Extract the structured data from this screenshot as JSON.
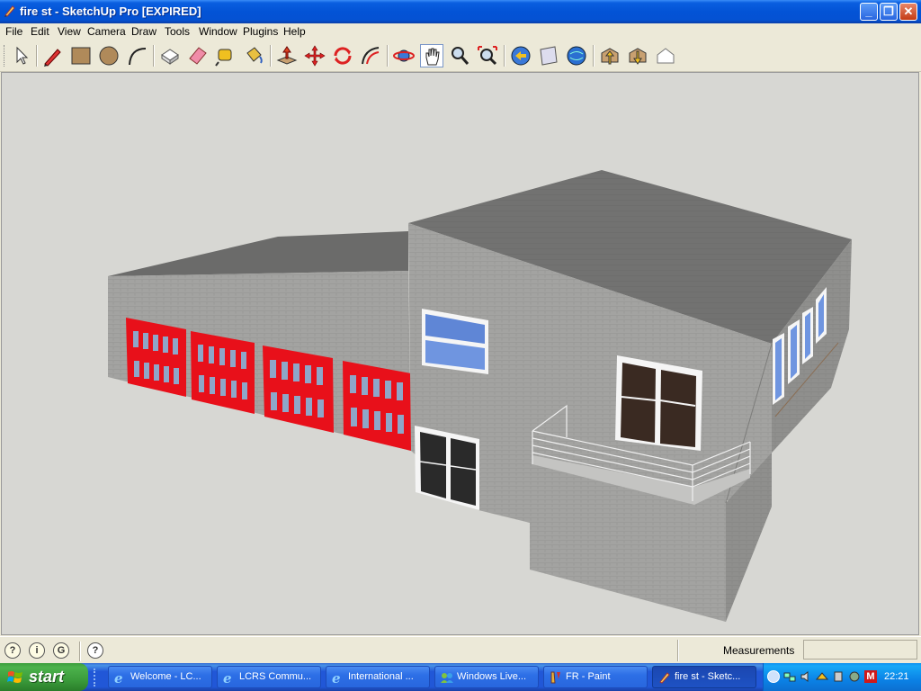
{
  "window": {
    "title": "fire st - SketchUp Pro [EXPIRED]",
    "controls": [
      "minimize",
      "restore",
      "close"
    ]
  },
  "menu": [
    "File",
    "Edit",
    "View",
    "Camera",
    "Draw",
    "Tools",
    "Window",
    "Plugins",
    "Help"
  ],
  "toolbar": {
    "tools": [
      "select-icon",
      "pencil-icon",
      "rectangle-icon",
      "circle-icon",
      "arc-icon",
      "make-component-icon",
      "eraser-icon",
      "tape-measure-icon",
      "paint-bucket-icon",
      "push-pull-icon",
      "move-icon",
      "rotate-icon",
      "offset-icon",
      "orbit-icon",
      "pan-icon",
      "zoom-icon",
      "zoom-extents-icon",
      "previous-view-icon",
      "next-view-icon",
      "get-models-icon",
      "share-model-icon",
      "get-components-icon",
      "share-component-icon"
    ],
    "active_tool": "pan-icon"
  },
  "viewport": {
    "background": "#d7d7d3",
    "model": "fire station building with four red garage doors, balcony and windows"
  },
  "statusbar": {
    "icons": [
      "geo-location-icon",
      "credits-icon",
      "google-sign-in-icon",
      "help-icon"
    ],
    "measurements_label": "Measurements",
    "measurements_value": ""
  },
  "taskbar": {
    "start_label": "start",
    "buttons": [
      {
        "icon": "ie-icon",
        "label": "Welcome - LC..."
      },
      {
        "icon": "ie-icon",
        "label": "LCRS Commu..."
      },
      {
        "icon": "ie-icon",
        "label": "International ..."
      },
      {
        "icon": "live-icon",
        "label": "Windows Live..."
      },
      {
        "icon": "paint-icon",
        "label": "FR - Paint"
      },
      {
        "icon": "sketchup-icon",
        "label": "fire st - Sketc..."
      }
    ],
    "active_index": 5,
    "clock": "22:21"
  },
  "colors": {
    "garage_door": "#e8101a",
    "wall": "#9d9d9b",
    "roof": "#6e6e6d",
    "window_glass": "#5f86d6",
    "title_bar": "#0353d6"
  }
}
